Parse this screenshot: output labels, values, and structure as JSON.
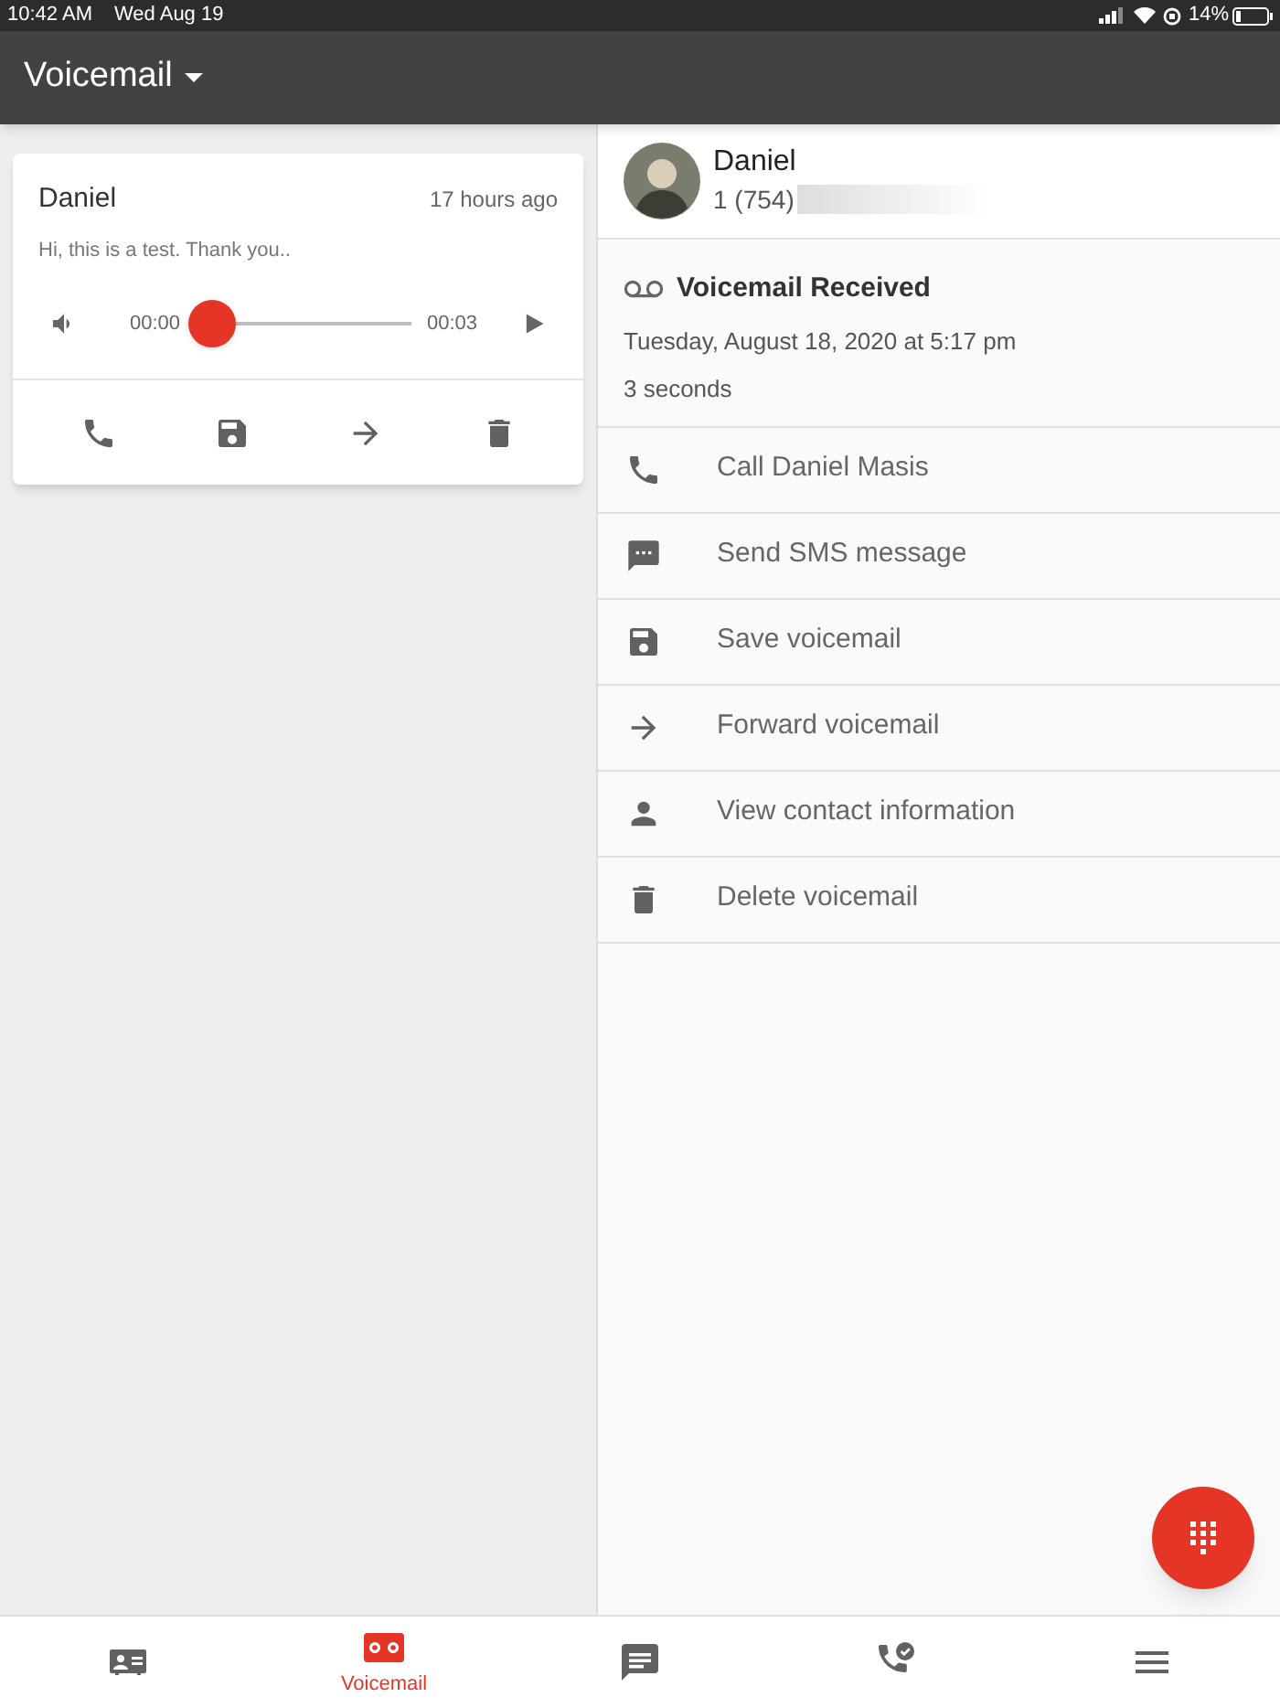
{
  "status_bar": {
    "time": "10:42 AM",
    "date": "Wed Aug 19",
    "battery": "14%"
  },
  "header": {
    "title": "Voicemail"
  },
  "voicemail_list": [
    {
      "name": "Daniel",
      "age": "17 hours ago",
      "transcript": "Hi, this is a test. Thank you..",
      "player": {
        "elapsed": "00:00",
        "duration": "00:03",
        "level": 0
      },
      "actions": [
        {
          "kind": "call"
        },
        {
          "kind": "save"
        },
        {
          "kind": "forward"
        },
        {
          "kind": "delete"
        }
      ]
    }
  ],
  "detail": {
    "contact": {
      "name": "Daniel",
      "number": "1 (754)"
    },
    "title": "Voicemail Received",
    "date": "Tuesday, August 18, 2020 at 5:17 pm",
    "duration": "3 seconds",
    "actions": [
      {
        "kind": "call",
        "label": "Call Daniel Masis"
      },
      {
        "kind": "sms",
        "label": "Send SMS message"
      },
      {
        "kind": "save",
        "label": "Save voicemail"
      },
      {
        "kind": "forward",
        "label": "Forward voicemail"
      },
      {
        "kind": "contact",
        "label": "View contact information"
      },
      {
        "kind": "delete",
        "label": "Delete voicemail"
      }
    ]
  },
  "bottom_nav": [
    {
      "kind": "contacts",
      "selected": false
    },
    {
      "kind": "voicemail",
      "label": "Voicemail",
      "selected": true
    },
    {
      "kind": "messages",
      "selected": false
    },
    {
      "kind": "calls",
      "selected": false
    },
    {
      "kind": "menu",
      "selected": false
    }
  ]
}
